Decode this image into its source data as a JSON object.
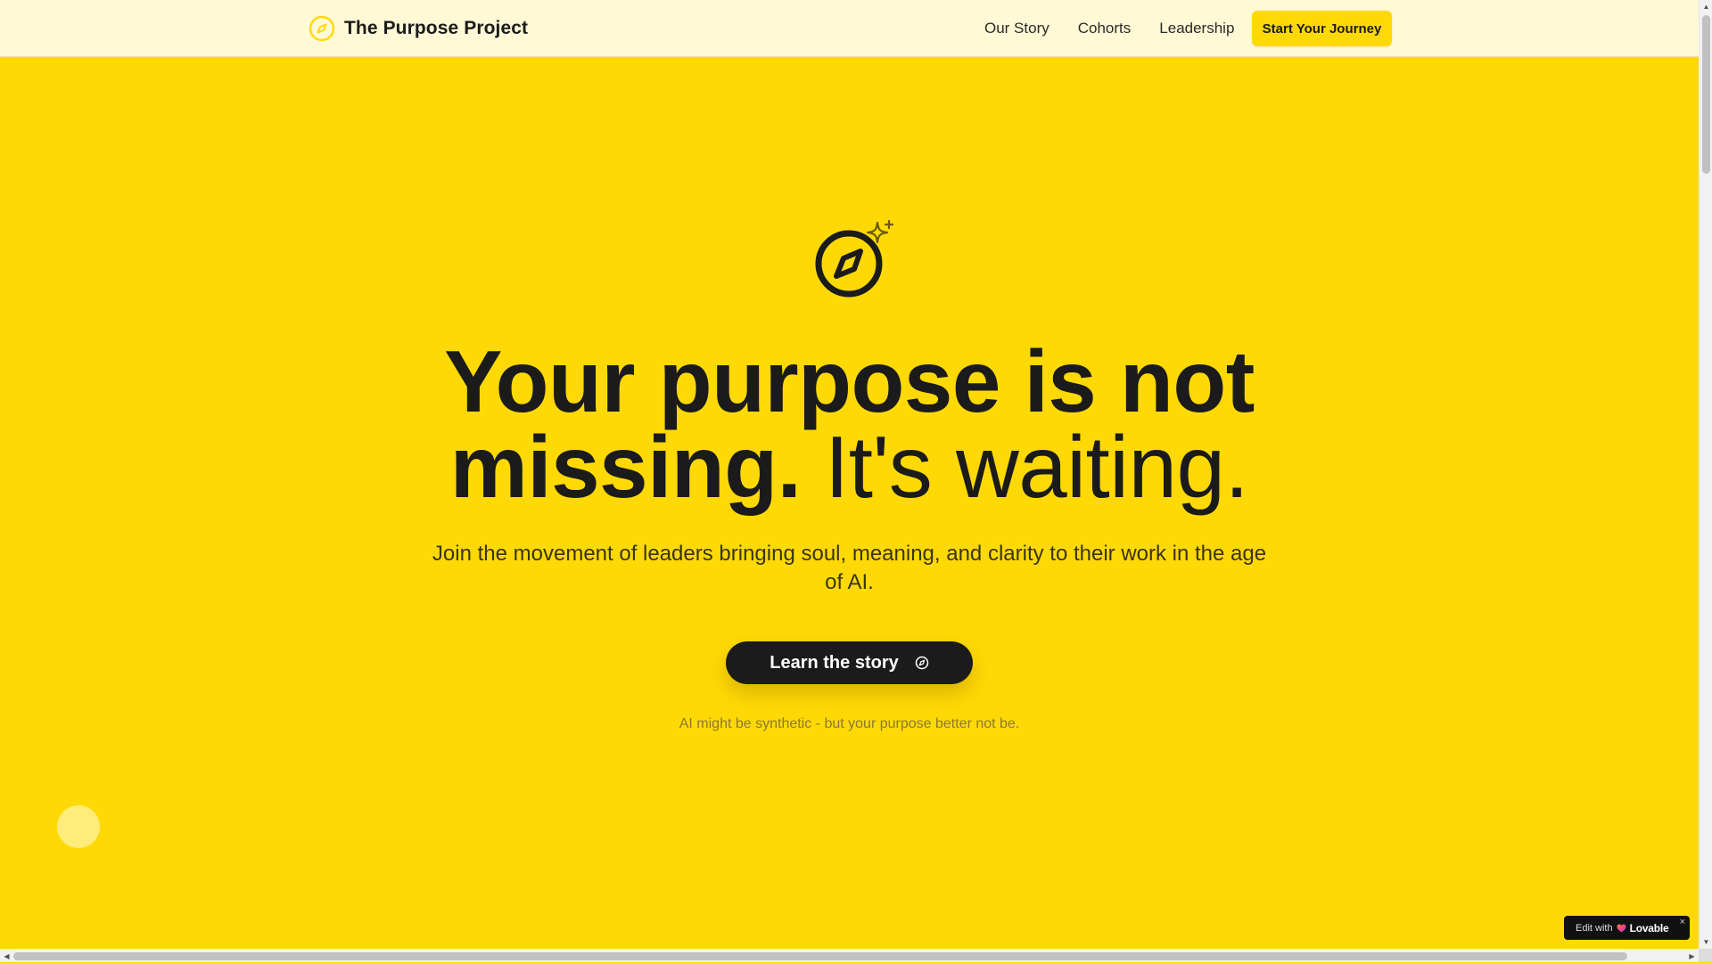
{
  "brand": {
    "name": "The Purpose Project",
    "icon": "compass-icon",
    "accent_color": "#FFD905"
  },
  "nav": {
    "links": [
      "Our Story",
      "Cohorts",
      "Leadership"
    ],
    "cta_label": "Start Your Journey"
  },
  "hero": {
    "icon": "compass-sparkle-icon",
    "headline_strong": "Your purpose is not missing.",
    "headline_light": "It's waiting.",
    "subheadline": "Join the movement of leaders bringing soul, meaning, and clarity to their work in the age of AI.",
    "cta_label": "Learn the story",
    "cta_icon": "compass-icon",
    "tagline": "AI might be synthetic - but your purpose better not be."
  },
  "badge": {
    "prefix": "Edit with",
    "brand": "Lovable",
    "close": "×"
  },
  "scrollbars": {
    "up": "▲",
    "down": "▼",
    "left": "◀",
    "right": "▶"
  }
}
